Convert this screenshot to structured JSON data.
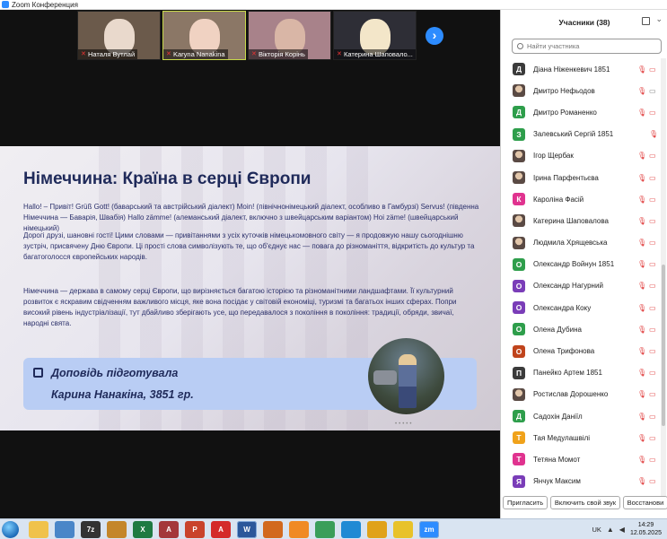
{
  "window": {
    "title": "Zoom Конференция"
  },
  "thumbnails": [
    {
      "name": "Наталя Вутлай",
      "face_color": "#e9d9cc",
      "bg": "#6b5a4b"
    },
    {
      "name": "Karyna Nanakina",
      "face_color": "#f0d2c2",
      "bg": "#8b7766",
      "active": true
    },
    {
      "name": "Вікторія Корінь",
      "face_color": "#d9b6a6",
      "bg": "#a8828a"
    },
    {
      "name": "Катерина Шаповало...",
      "face_color": "#f3e6c9",
      "bg": "#2e2e36"
    }
  ],
  "slide": {
    "title": "Німеччина: Країна в серці Європи",
    "p1": "Hallo! – Привіт! Grüß Gott! (баварський та австрійський діалект) Moin! (північнонімецький діалект, особливо в Гамбурзі) Servus! (південна Німеччина — Баварія, Швабія) Hallo zämme! (алеманський діалект, включно з швейцарським варіантом) Hoi zäme! (швейцарський німецький)",
    "p2": "Дорогі друзі, шановні гості! Цими словами — привітаннями з усіх куточків німецькомовного світу — я продовжую нашу сьогоднішню зустріч, присвячену Дню Європи. Ці прості слова символізують те, що об'єднує нас — повага до різноманіття, відкритість до культур та багатоголосся європейських народів.",
    "p3": "Німеччина — держава в самому серці Європи, що вирізняється багатою історією та різноманітними ландшафтами. Її культурний розвиток є яскравим свідченням важливого місця, яке вона посідає у світовій економіці, туризмі та багатьох інших сферах. Попри високий рівень індустріалізації, тут дбайливо зберігають усе, що передавалося з покоління в покоління: традиції, обряди, звичаї, народні свята.",
    "report_line1": "Доповідь підготувала",
    "report_line2": "Карина Нанакіна, 3851 гр."
  },
  "panel": {
    "title": "Учасники (38)",
    "search_placeholder": "Найти участника",
    "participants": [
      {
        "initial": "Д",
        "color": "#3b3b3b",
        "name": "Діана Ніженкевич 1851",
        "cam_off": true
      },
      {
        "initial": "",
        "color": "photo",
        "name": "Дмитро Нефьодов",
        "cam_off": false
      },
      {
        "initial": "Д",
        "color": "#2e9e4b",
        "name": "Дмитро Романенко",
        "cam_off": true
      },
      {
        "initial": "З",
        "color": "#2e9e4b",
        "name": "Залевський Сергій 1851",
        "cam_off": false,
        "mic_only": true
      },
      {
        "initial": "",
        "color": "photo",
        "name": "Ігор Щербак",
        "cam_off": true
      },
      {
        "initial": "",
        "color": "photo",
        "name": "Ірина Парфентьєва",
        "cam_off": true
      },
      {
        "initial": "К",
        "color": "#e0338f",
        "name": "Кароліна Фасій",
        "cam_off": true
      },
      {
        "initial": "",
        "color": "photo",
        "name": "Катерина Шаповалова",
        "cam_off": true
      },
      {
        "initial": "",
        "color": "photo",
        "name": "Людмила Хрящевська",
        "cam_off": true
      },
      {
        "initial": "О",
        "color": "#2e9e4b",
        "name": "Олександр Войнун 1851",
        "cam_off": true
      },
      {
        "initial": "О",
        "color": "#7a3db8",
        "name": "Олександр Нагурний",
        "cam_off": true
      },
      {
        "initial": "О",
        "color": "#7a3db8",
        "name": "Олександра Коку",
        "cam_off": true
      },
      {
        "initial": "О",
        "color": "#2e9e4b",
        "name": "Олена Дубина",
        "cam_off": true
      },
      {
        "initial": "О",
        "color": "#c0441c",
        "name": "Олена Трифонова",
        "cam_off": true
      },
      {
        "initial": "П",
        "color": "#3b3b3b",
        "name": "Панейко Артем 1851",
        "cam_off": true
      },
      {
        "initial": "",
        "color": "photo",
        "name": "Ростислав Дорошенко",
        "cam_off": true
      },
      {
        "initial": "Д",
        "color": "#2e9e4b",
        "name": "Садохін Даніїл",
        "cam_off": true
      },
      {
        "initial": "Т",
        "color": "#f0a21a",
        "name": "Тая Медулашвілі",
        "cam_off": true
      },
      {
        "initial": "Т",
        "color": "#e0338f",
        "name": "Тетяна Момот",
        "cam_off": true
      },
      {
        "initial": "Я",
        "color": "#7a3db8",
        "name": "Янчук Максим",
        "cam_off": true
      }
    ],
    "buttons": {
      "invite": "Пригласить",
      "unmute": "Включить свой звук",
      "restore": "Восстанови"
    }
  },
  "taskbar": {
    "apps": [
      {
        "name": "explorer",
        "label": "",
        "color": "#f0c24b"
      },
      {
        "name": "ie-tool",
        "label": "",
        "color": "#4a86c8"
      },
      {
        "name": "7zip",
        "label": "7z",
        "color": "#333"
      },
      {
        "name": "paw",
        "label": "",
        "color": "#c4862a"
      },
      {
        "name": "excel",
        "label": "X",
        "color": "#1e7a42"
      },
      {
        "name": "access",
        "label": "A",
        "color": "#a4373a"
      },
      {
        "name": "powerpoint",
        "label": "P",
        "color": "#c9432b"
      },
      {
        "name": "acrobat",
        "label": "A",
        "color": "#d42a2a"
      },
      {
        "name": "word",
        "label": "W",
        "color": "#2b579a",
        "active": true
      },
      {
        "name": "pen",
        "label": "",
        "color": "#d2691e"
      },
      {
        "name": "media",
        "label": "",
        "color": "#f08a24"
      },
      {
        "name": "drive",
        "label": "",
        "color": "#3a9e5a"
      },
      {
        "name": "edge",
        "label": "",
        "color": "#1f8ad4"
      },
      {
        "name": "chrome",
        "label": "",
        "color": "#e0a21a"
      },
      {
        "name": "acrobat-triangle",
        "label": "",
        "color": "#e8c22a"
      },
      {
        "name": "zoom",
        "label": "zm",
        "color": "#2d8cff",
        "active": true
      }
    ],
    "lang": "UK",
    "time": "14:29",
    "date": "12.05.2025"
  }
}
